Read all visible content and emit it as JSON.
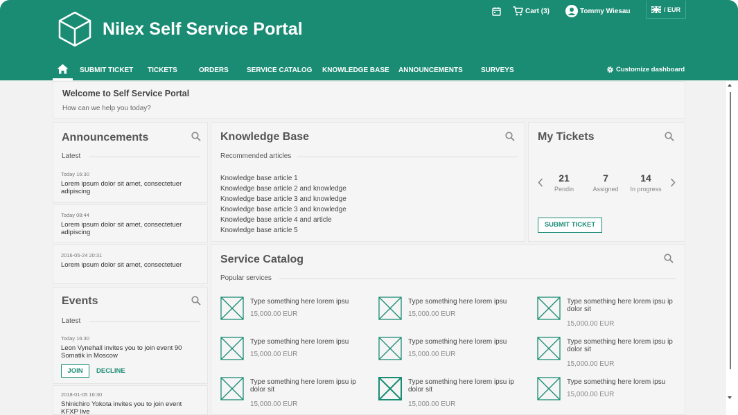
{
  "header": {
    "title": "Nilex Self Service Portal",
    "cart_label": "Cart (3)",
    "user_name": "Tommy Wiesau",
    "currency": "/ EUR",
    "accent_color": "#1a8c74"
  },
  "nav": {
    "items": [
      "SUBMIT TICKET",
      "TICKETS",
      "ORDERS",
      "SERVICE CATALOG",
      "KNOWLEDGE BASE",
      "ANNOUNCEMENTS",
      "SURVEYS"
    ],
    "customize_label": "Customize dashboard"
  },
  "welcome": {
    "title": "Welcome to Self Service Portal",
    "subtitle": "How can we help you today?"
  },
  "announcements": {
    "title": "Announcements",
    "latest_label": "Latest",
    "items": [
      {
        "time": "Today   16:30",
        "text": "Lorem ipsum dolor sit amet, consectetuer adipiscing"
      },
      {
        "time": "Today   08:44",
        "text": "Lorem ipsum dolor sit amet, consectetuer adipiscing"
      },
      {
        "time": "2016-05-24   20:31",
        "text": "Lorem ipsum dolor sit amet, consectetuer"
      }
    ]
  },
  "events": {
    "title": "Events",
    "latest_label": "Latest",
    "items": [
      {
        "time": "Today  16:30",
        "text": "Leon Vynehall invites you to join event 90 Somatik in Moscow"
      },
      {
        "time": "2018-01-05  16:30",
        "text": "Shinichiro Yokota invites you to join event KFXP live"
      }
    ],
    "join_label": "JOIN",
    "decline_label": "DECLINE"
  },
  "knowledge_base": {
    "title": "Knowledge Base",
    "recommended_label": "Recommended articles",
    "articles": [
      "Knowledge base article 1",
      "Knowledge base article 2 and knowledge",
      "Knowledge base article 3 and knowledge",
      "Knowledge base article 3 and knowledge",
      "Knowledge base article 4 and article",
      "Knowledge base article 5"
    ]
  },
  "my_tickets": {
    "title": "My Tickets",
    "stats": [
      {
        "value": "21",
        "label": "Pendin"
      },
      {
        "value": "7",
        "label": "Assigned"
      },
      {
        "value": "14",
        "label": "In progress"
      }
    ],
    "submit_label": "SUBMIT TICKET"
  },
  "service_catalog": {
    "title": "Service Catalog",
    "popular_label": "Popular services",
    "items": [
      {
        "name": "Type something here lorem ipsu",
        "price": "15,000.00 EUR"
      },
      {
        "name": "Type something here lorem ipsu",
        "price": "15,000.00 EUR"
      },
      {
        "name": "Type something here lorem ipsu ip dolor sit",
        "price": "15,000.00 EUR"
      },
      {
        "name": "Type something here lorem ipsu",
        "price": "15,000.00 EUR"
      },
      {
        "name": "Type something here lorem ipsu",
        "price": "15,000.00 EUR"
      },
      {
        "name": "Type something here lorem ipsu ip dolor sit",
        "price": "15,000.00 EUR"
      },
      {
        "name": "Type something here lorem ipsu ip dolor sit",
        "price": "15,000.00 EUR"
      },
      {
        "name": "Type something here lorem ipsu ip dolor sit",
        "price": "15,000.00 EUR"
      },
      {
        "name": "Type something here lorem ipsu",
        "price": "15,000.00 EUR"
      }
    ]
  }
}
